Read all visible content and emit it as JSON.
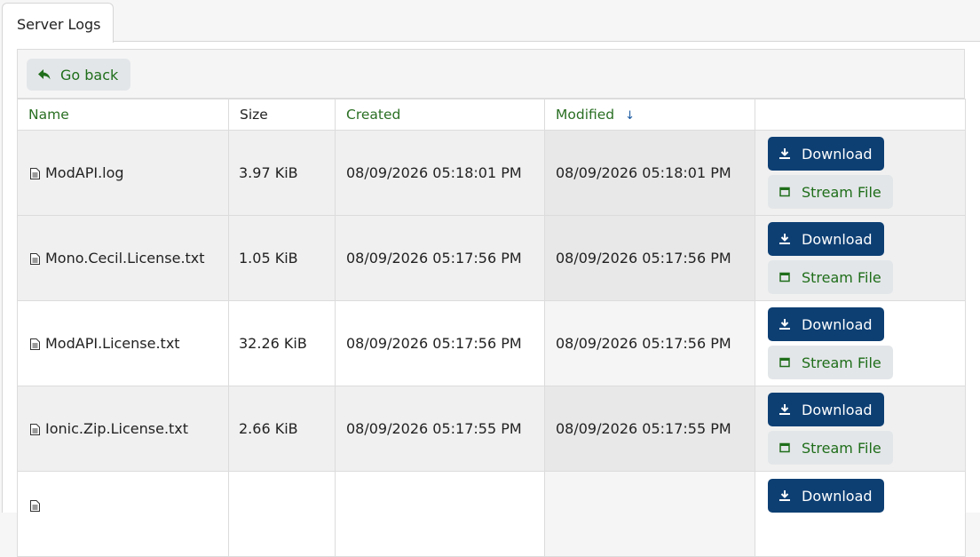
{
  "tab": {
    "label": "Server Logs"
  },
  "toolbar": {
    "go_back_label": "Go back"
  },
  "table": {
    "columns": {
      "name": "Name",
      "size": "Size",
      "created": "Created",
      "modified": "Modified"
    },
    "sort": {
      "column": "Modified",
      "direction": "descending",
      "icon": "arrow-down-icon"
    },
    "actions": {
      "download_label": "Download",
      "stream_label": "Stream File"
    },
    "rows": [
      {
        "name": "ModAPI.log",
        "size": "3.97 KiB",
        "created": "08/09/2026 05:18:01 PM",
        "modified": "08/09/2026 05:18:01 PM"
      },
      {
        "name": "Mono.Cecil.License.txt",
        "size": "1.05 KiB",
        "created": "08/09/2026 05:17:56 PM",
        "modified": "08/09/2026 05:17:56 PM"
      },
      {
        "name": "ModAPI.License.txt",
        "size": "32.26 KiB",
        "created": "08/09/2026 05:17:56 PM",
        "modified": "08/09/2026 05:17:56 PM"
      },
      {
        "name": "Ionic.Zip.License.txt",
        "size": "2.66 KiB",
        "created": "08/09/2026 05:17:55 PM",
        "modified": "08/09/2026 05:17:55 PM"
      },
      {
        "name": "",
        "size": "",
        "created": "",
        "modified": ""
      }
    ]
  },
  "colors": {
    "download_button": "#0d3f73",
    "link_green": "#1f6e1a",
    "secondary_button": "#e3e6e9",
    "sort_arrow": "#1b5aa0"
  }
}
